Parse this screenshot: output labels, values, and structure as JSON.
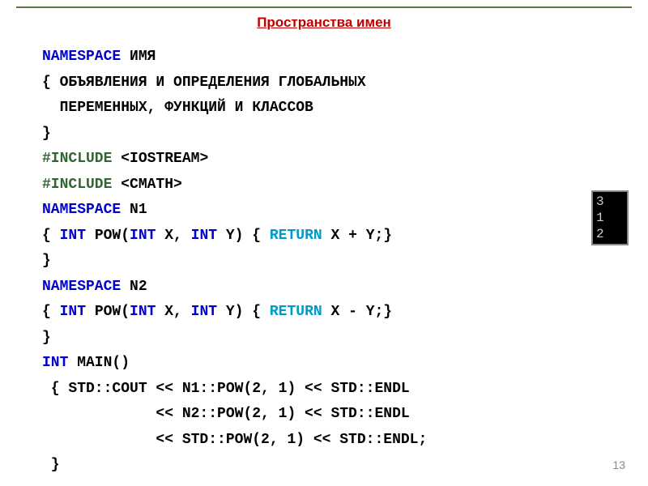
{
  "title": "Пространства имен ",
  "code": {
    "l1_kw": "NAMESPACE",
    "l1_txt": " ИМЯ",
    "l2": "{ ОБЪЯВЛЕНИЯ И ОПРЕДЕЛЕНИЯ ГЛОБАЛЬНЫХ",
    "l3": "  ПЕРЕМЕННЫХ, ФУНКЦИЙ И КЛАССОВ",
    "l4": "}",
    "l5_pre": "#INCLUDE",
    "l5_txt": " <IOSTREAM>",
    "l6_pre": "#INCLUDE",
    "l6_txt": " <CMATH>",
    "l7_kw": "NAMESPACE",
    "l7_txt": " N1",
    "l8_a": "{ ",
    "l8_int1": "INT",
    "l8_b": " POW(",
    "l8_int2": "INT",
    "l8_c": " X, ",
    "l8_int3": "INT",
    "l8_d": " Y) { ",
    "l8_ret": "RETURN",
    "l8_e": " X + Y;}",
    "l9": "}",
    "l10_kw": "NAMESPACE",
    "l10_txt": " N2",
    "l11_a": "{ ",
    "l11_int1": "INT",
    "l11_b": " POW(",
    "l11_int2": "INT",
    "l11_c": " X, ",
    "l11_int3": "INT",
    "l11_d": " Y) { ",
    "l11_ret": "RETURN",
    "l11_e": " X - Y;}",
    "l12": "}",
    "l13_int": "INT",
    "l13_txt": " MAIN()",
    "l14": " { STD::COUT << N1::POW(2, 1) << STD::ENDL",
    "l15": "             << N2::POW(2, 1) << STD::ENDL",
    "l16": "             << STD::POW(2, 1) << STD::ENDL;",
    "l17": " }"
  },
  "output": {
    "line1": "3",
    "line2": "1",
    "line3": "2"
  },
  "page_number": "13",
  "chart_data": null
}
